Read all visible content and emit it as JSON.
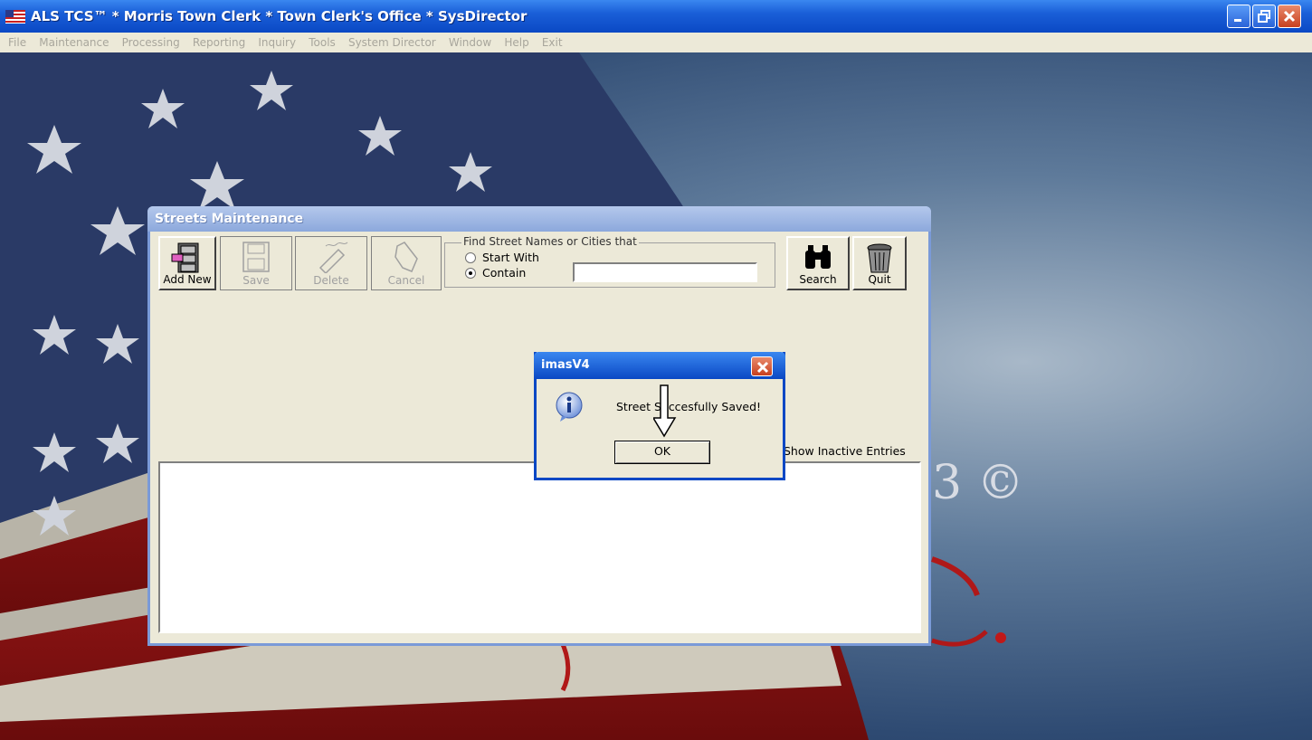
{
  "window": {
    "title": "ALS TCS™ * Morris Town Clerk * Town Clerk's Office * SysDirector",
    "icon": "us-flag-icon",
    "controls": [
      "minimize-icon",
      "restore-icon",
      "close-icon"
    ]
  },
  "menu": {
    "items": [
      "File",
      "Maintenance",
      "Processing",
      "Reporting",
      "Inquiry",
      "Tools",
      "System Director",
      "Window",
      "Help",
      "Exit"
    ]
  },
  "background": {
    "fragment_text": "3 ©"
  },
  "streets": {
    "title": "Streets Maintenance",
    "toolbar": {
      "add_new": "Add New",
      "save": "Save",
      "delete": "Delete",
      "cancel": "Cancel",
      "search": "Search",
      "quit": "Quit"
    },
    "find": {
      "legend": "Find Street Names or Cities that",
      "option_start": "Start With",
      "option_contain": "Contain",
      "selected": "Contain",
      "value": ""
    },
    "show_inactive": "Show Inactive Entries"
  },
  "dialog": {
    "title": "imasV4",
    "message": "Street Succesfully Saved!",
    "ok": "OK",
    "icon": "info-icon"
  },
  "colors": {
    "titlebar": "#0a48c4",
    "face": "#ece9d8",
    "close": "#c8401f"
  }
}
